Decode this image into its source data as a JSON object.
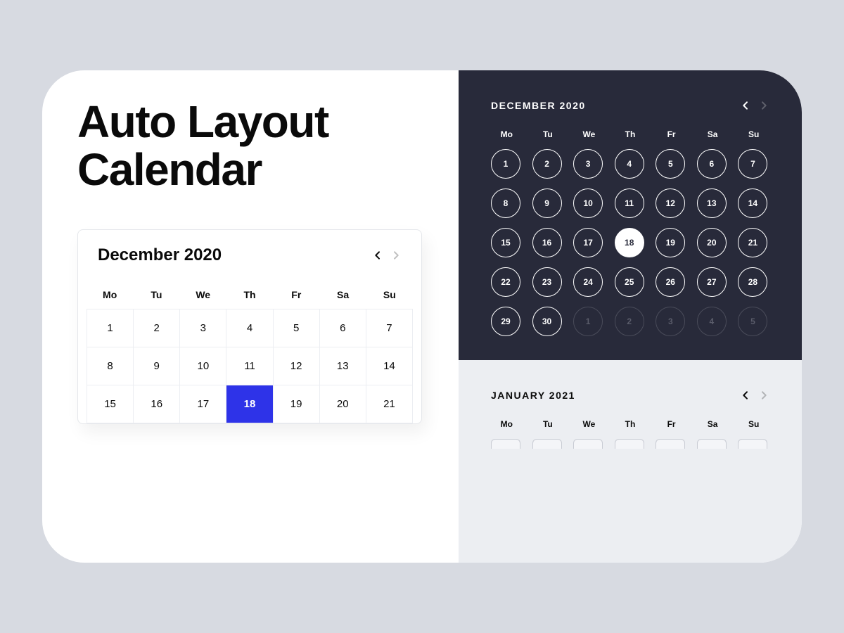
{
  "title": "Auto Layout\nCalendar",
  "dow": [
    "Mo",
    "Tu",
    "We",
    "Th",
    "Fr",
    "Sa",
    "Su"
  ],
  "lightCalendar": {
    "title": "December 2020",
    "selectedDay": 18,
    "days": [
      1,
      2,
      3,
      4,
      5,
      6,
      7,
      8,
      9,
      10,
      11,
      12,
      13,
      14,
      15,
      16,
      17,
      18,
      19,
      20,
      21
    ]
  },
  "darkCalendar": {
    "title": "DECEMBER 2020",
    "selectedDay": 18,
    "days": [
      {
        "n": 1
      },
      {
        "n": 2
      },
      {
        "n": 3
      },
      {
        "n": 4
      },
      {
        "n": 5
      },
      {
        "n": 6
      },
      {
        "n": 7
      },
      {
        "n": 8
      },
      {
        "n": 9
      },
      {
        "n": 10
      },
      {
        "n": 11
      },
      {
        "n": 12
      },
      {
        "n": 13
      },
      {
        "n": 14
      },
      {
        "n": 15
      },
      {
        "n": 16
      },
      {
        "n": 17
      },
      {
        "n": 18
      },
      {
        "n": 19
      },
      {
        "n": 20
      },
      {
        "n": 21
      },
      {
        "n": 22
      },
      {
        "n": 23
      },
      {
        "n": 24
      },
      {
        "n": 25
      },
      {
        "n": 26
      },
      {
        "n": 27
      },
      {
        "n": 28
      },
      {
        "n": 29
      },
      {
        "n": 30
      },
      {
        "n": 1,
        "muted": true
      },
      {
        "n": 2,
        "muted": true
      },
      {
        "n": 3,
        "muted": true
      },
      {
        "n": 4,
        "muted": true
      },
      {
        "n": 5,
        "muted": true
      }
    ]
  },
  "secondaryCalendar": {
    "title": "JANUARY 2021"
  },
  "colors": {
    "accent": "#2e33e8",
    "dark": "#282a3a",
    "pageBg": "#d7dae1",
    "lightPanel": "#eceef2"
  }
}
